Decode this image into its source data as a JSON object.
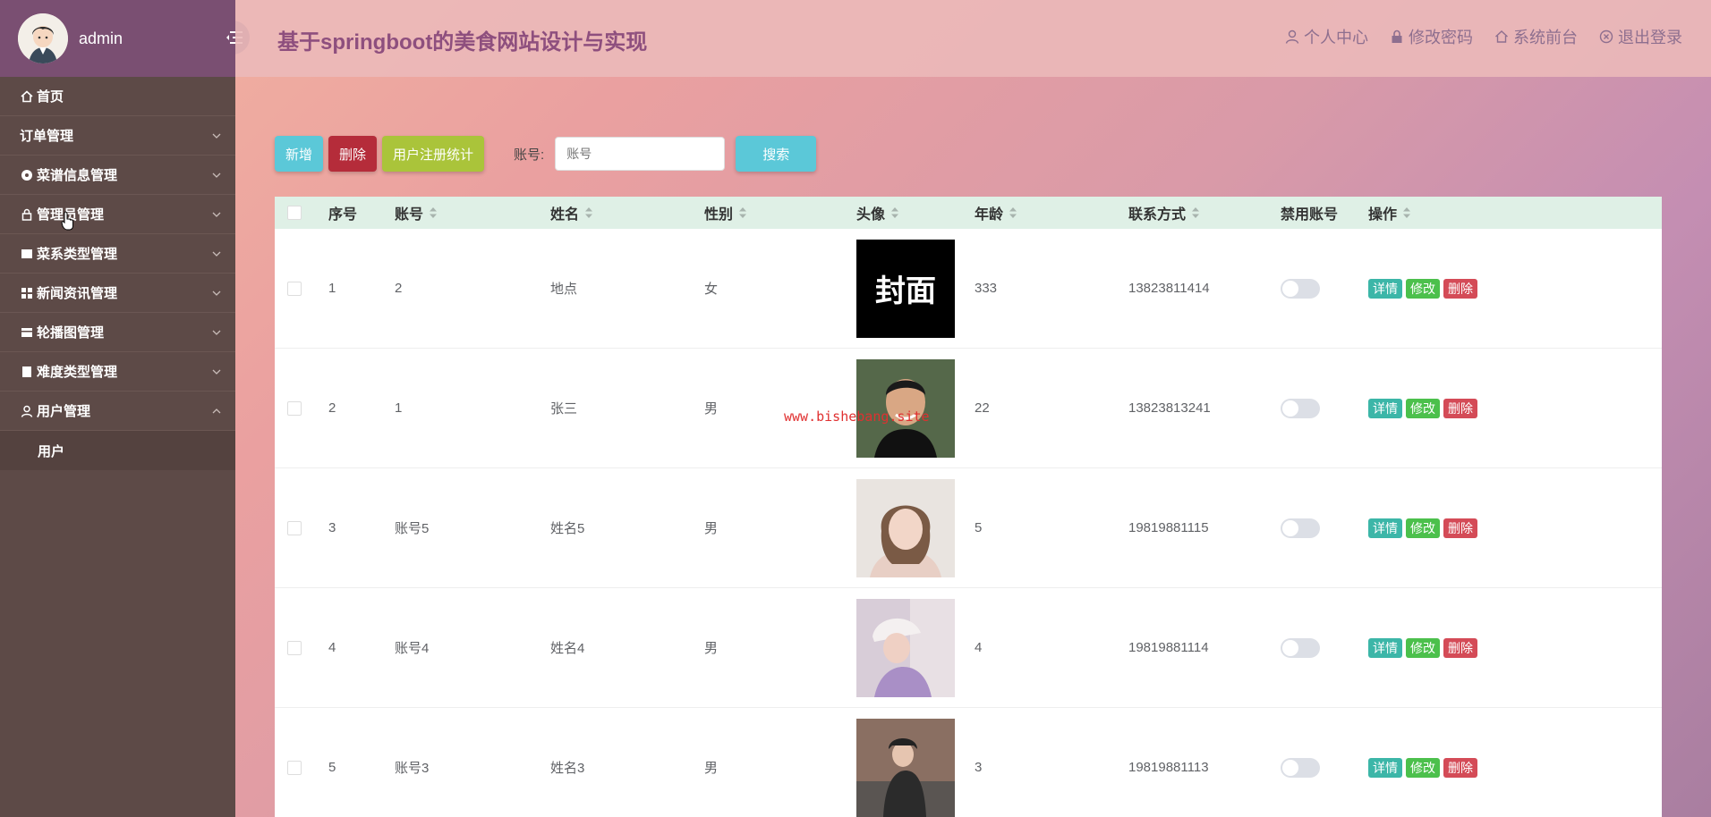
{
  "sidebar": {
    "username": "admin",
    "menu": [
      {
        "label": "首页",
        "icon": "home-icon",
        "expandable": false
      },
      {
        "label": "订单管理",
        "icon": "",
        "expandable": true
      },
      {
        "label": "菜谱信息管理",
        "icon": "dot-icon",
        "expandable": true
      },
      {
        "label": "管理员管理",
        "icon": "lock-icon",
        "expandable": true
      },
      {
        "label": "菜系类型管理",
        "icon": "square-icon",
        "expandable": true
      },
      {
        "label": "新闻资讯管理",
        "icon": "grid-icon",
        "expandable": true
      },
      {
        "label": "轮播图管理",
        "icon": "card-icon",
        "expandable": true
      },
      {
        "label": "难度类型管理",
        "icon": "doc-icon",
        "expandable": true
      },
      {
        "label": "用户管理",
        "icon": "user-icon",
        "expandable": true,
        "expanded": true
      }
    ],
    "submenu": [
      {
        "label": "用户"
      }
    ]
  },
  "header": {
    "title": "基于springboot的美食网站设计与实现",
    "links": [
      {
        "label": "个人中心",
        "icon": "user-icon"
      },
      {
        "label": "修改密码",
        "icon": "lock-icon"
      },
      {
        "label": "系统前台",
        "icon": "home-icon"
      },
      {
        "label": "退出登录",
        "icon": "close-circle-icon"
      }
    ]
  },
  "toolbar": {
    "add_label": "新增",
    "delete_label": "删除",
    "stats_label": "用户注册统计",
    "search_label": "账号:",
    "search_placeholder": "账号",
    "search_button": "搜索"
  },
  "table": {
    "headers": [
      "序号",
      "账号",
      "姓名",
      "性别",
      "头像",
      "年龄",
      "联系方式",
      "禁用账号",
      "操作"
    ],
    "actions": {
      "detail": "详情",
      "edit": "修改",
      "delete": "删除"
    },
    "rows": [
      {
        "index": "1",
        "account": "2",
        "name": "地点",
        "gender": "女",
        "avatar_text": "封面",
        "age": "333",
        "phone": "13823811414",
        "disabled": false
      },
      {
        "index": "2",
        "account": "1",
        "name": "张三",
        "gender": "男",
        "avatar_text": "",
        "age": "22",
        "phone": "13823813241",
        "disabled": false
      },
      {
        "index": "3",
        "account": "账号5",
        "name": "姓名5",
        "gender": "男",
        "avatar_text": "",
        "age": "5",
        "phone": "19819881115",
        "disabled": false
      },
      {
        "index": "4",
        "account": "账号4",
        "name": "姓名4",
        "gender": "男",
        "avatar_text": "",
        "age": "4",
        "phone": "19819881114",
        "disabled": false
      },
      {
        "index": "5",
        "account": "账号3",
        "name": "姓名3",
        "gender": "男",
        "avatar_text": "",
        "age": "3",
        "phone": "19819881113",
        "disabled": false
      }
    ]
  },
  "watermark": "www.bishebang.site",
  "colors": {
    "sidebar_bg": "#5d4a47",
    "sidebar_header": "#7a4f72",
    "title": "#8e4f7e",
    "table_header_bg": "#dff0e6",
    "add_button": "#5bc8d8",
    "delete_button": "#b52c3a",
    "stats_button": "#aac43a"
  }
}
